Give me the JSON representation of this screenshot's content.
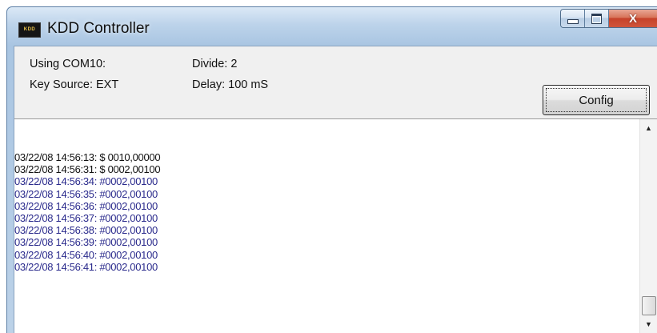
{
  "window": {
    "title": "KDD Controller",
    "icon_text": "KDD",
    "close_glyph": "X"
  },
  "info": {
    "port": "Using COM10:",
    "divide": "Divide: 2",
    "key_source": "Key Source: EXT",
    "delay": "Delay: 100 mS"
  },
  "config_button": {
    "label": "Config"
  },
  "log": {
    "entries": [
      {
        "text": "03/22/08 14:56:13: $ 0010,00000",
        "color": "#121212"
      },
      {
        "text": "03/22/08 14:56:31: $ 0002,00100",
        "color": "#121212"
      },
      {
        "text": "03/22/08 14:56:34: #0002,00100",
        "color": "#2a2a8c"
      },
      {
        "text": "03/22/08 14:56:35: #0002,00100",
        "color": "#2a2a8c"
      },
      {
        "text": "03/22/08 14:56:36: #0002,00100",
        "color": "#2a2a8c"
      },
      {
        "text": "03/22/08 14:56:37: #0002,00100",
        "color": "#2a2a8c"
      },
      {
        "text": "03/22/08 14:56:38: #0002,00100",
        "color": "#2a2a8c"
      },
      {
        "text": "03/22/08 14:56:39: #0002,00100",
        "color": "#2a2a8c"
      },
      {
        "text": "03/22/08 14:56:40: #0002,00100",
        "color": "#2a2a8c"
      },
      {
        "text": "03/22/08 14:56:41: #0002,00100",
        "color": "#2a2a8c"
      }
    ]
  },
  "scrollbar": {
    "up_icon": "scroll-up-arrow",
    "down_icon": "scroll-down-arrow",
    "position": "bottom"
  }
}
